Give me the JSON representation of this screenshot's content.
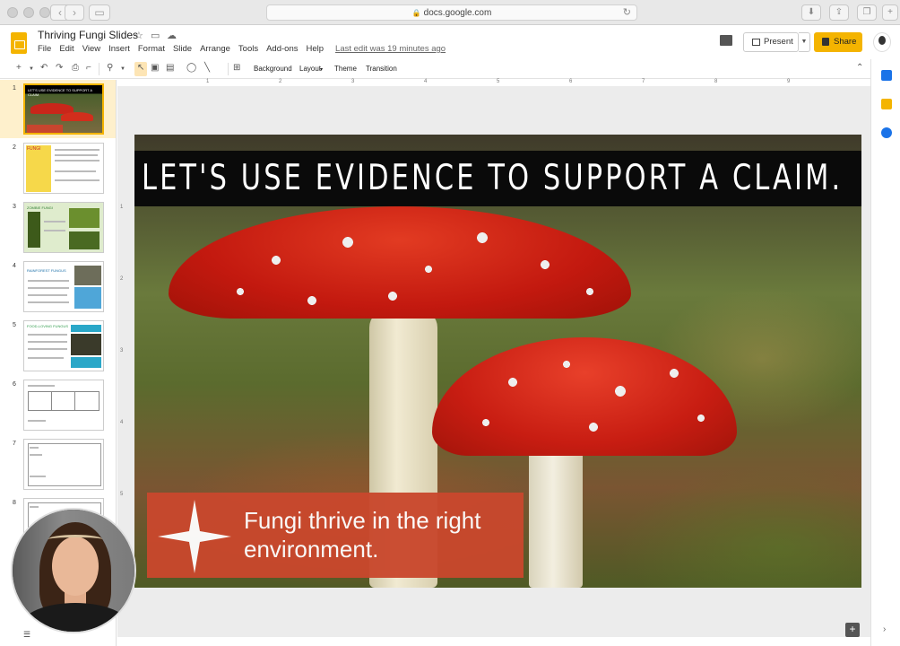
{
  "browser": {
    "url": "docs.google.com"
  },
  "doc": {
    "title": "Thriving Fungi Slides",
    "last_edit": "Last edit was 19 minutes ago",
    "menu": [
      "File",
      "Edit",
      "View",
      "Insert",
      "Format",
      "Slide",
      "Arrange",
      "Tools",
      "Add-ons",
      "Help"
    ],
    "present_label": "Present",
    "share_label": "Share"
  },
  "toolbar": {
    "background_label": "Background",
    "layout_label": "Layout",
    "theme_label": "Theme",
    "transition_label": "Transition"
  },
  "ruler": {
    "top": [
      "1",
      "2",
      "3",
      "4",
      "5",
      "6",
      "7",
      "8",
      "9"
    ],
    "left": [
      "1",
      "2",
      "3",
      "4",
      "5"
    ]
  },
  "filmstrip": {
    "slide_numbers": [
      "1",
      "2",
      "3",
      "4",
      "5",
      "6",
      "7",
      "8"
    ],
    "selected": 1,
    "thumb_titles": {
      "slide1": "LET'S USE EVIDENCE TO SUPPORT A CLAIM.",
      "slide2": "FUNGI",
      "slide3": "ZOMBIE FUNGI",
      "slide4": "RAINFOREST FUNGUS",
      "slide5": "FOOD-LOVING FUNGUS"
    }
  },
  "slide": {
    "title": "LET'S USE EVIDENCE TO SUPPORT A CLAIM.",
    "claim": "Fungi thrive in the right environment.",
    "colors": {
      "title_bar": "#0a0a0a",
      "claim_box": "#c9482d",
      "cap_red": "#c81d12"
    }
  },
  "accent_colors": {
    "slides_yellow": "#f4b400"
  }
}
